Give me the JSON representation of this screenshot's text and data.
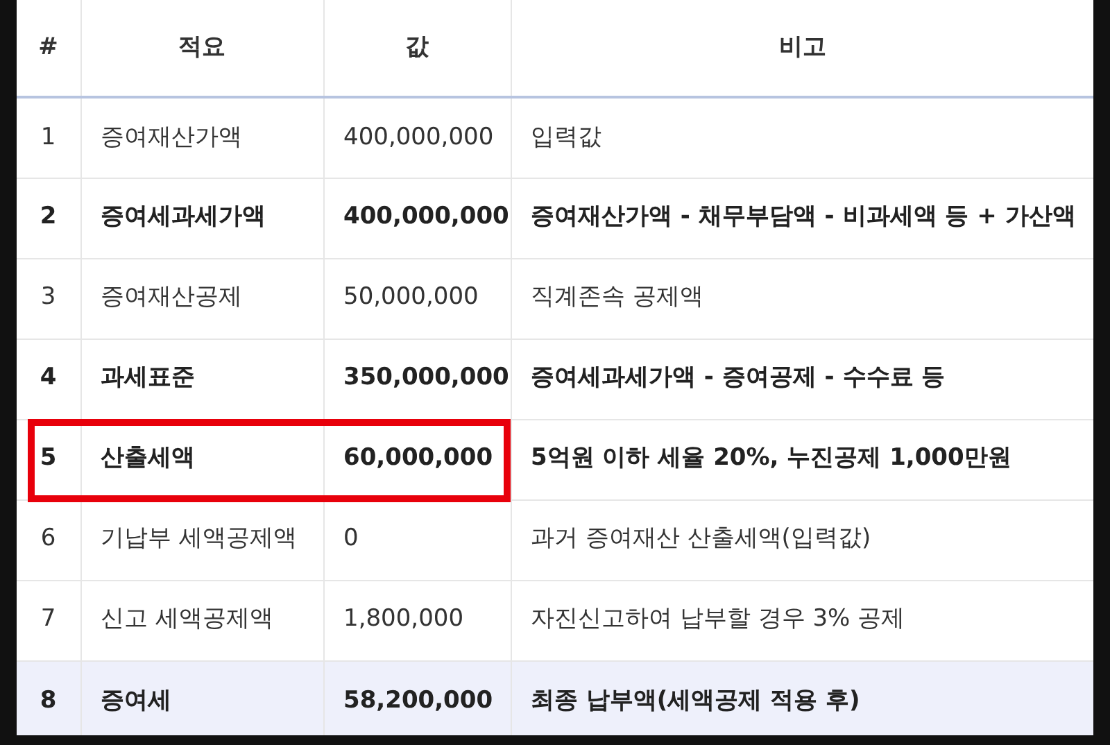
{
  "table": {
    "columns": [
      "#",
      "적요",
      "값",
      "비고"
    ],
    "rows": [
      {
        "cells": [
          "1",
          "증여재산가액",
          "400,000,000",
          "입력값"
        ],
        "bold": false,
        "highlighted": false,
        "boxed": false
      },
      {
        "cells": [
          "2",
          "증여세과세가액",
          "400,000,000",
          "증여재산가액 - 채무부담액 - 비과세액 등 + 가산액"
        ],
        "bold": true,
        "highlighted": false,
        "boxed": false
      },
      {
        "cells": [
          "3",
          "증여재산공제",
          "50,000,000",
          "직계존속 공제액"
        ],
        "bold": false,
        "highlighted": false,
        "boxed": false
      },
      {
        "cells": [
          "4",
          "과세표준",
          "350,000,000",
          "증여세과세가액 - 증여공제 - 수수료 등"
        ],
        "bold": true,
        "highlighted": false,
        "boxed": false
      },
      {
        "cells": [
          "5",
          "산출세액",
          "60,000,000",
          "5억원 이하 세율 20%, 누진공제 1,000만원"
        ],
        "bold": true,
        "highlighted": false,
        "boxed": true
      },
      {
        "cells": [
          "6",
          "기납부 세액공제액",
          "0",
          "과거 증여재산 산출세액(입력값)"
        ],
        "bold": false,
        "highlighted": false,
        "boxed": false
      },
      {
        "cells": [
          "7",
          "신고 세액공제액",
          "1,800,000",
          "자진신고하여 납부할 경우 3% 공제"
        ],
        "bold": false,
        "highlighted": false,
        "boxed": false
      },
      {
        "cells": [
          "8",
          "증여세",
          "58,200,000",
          "최종 납부액(세액공제 적용 후)"
        ],
        "bold": true,
        "highlighted": true,
        "boxed": false
      }
    ]
  }
}
